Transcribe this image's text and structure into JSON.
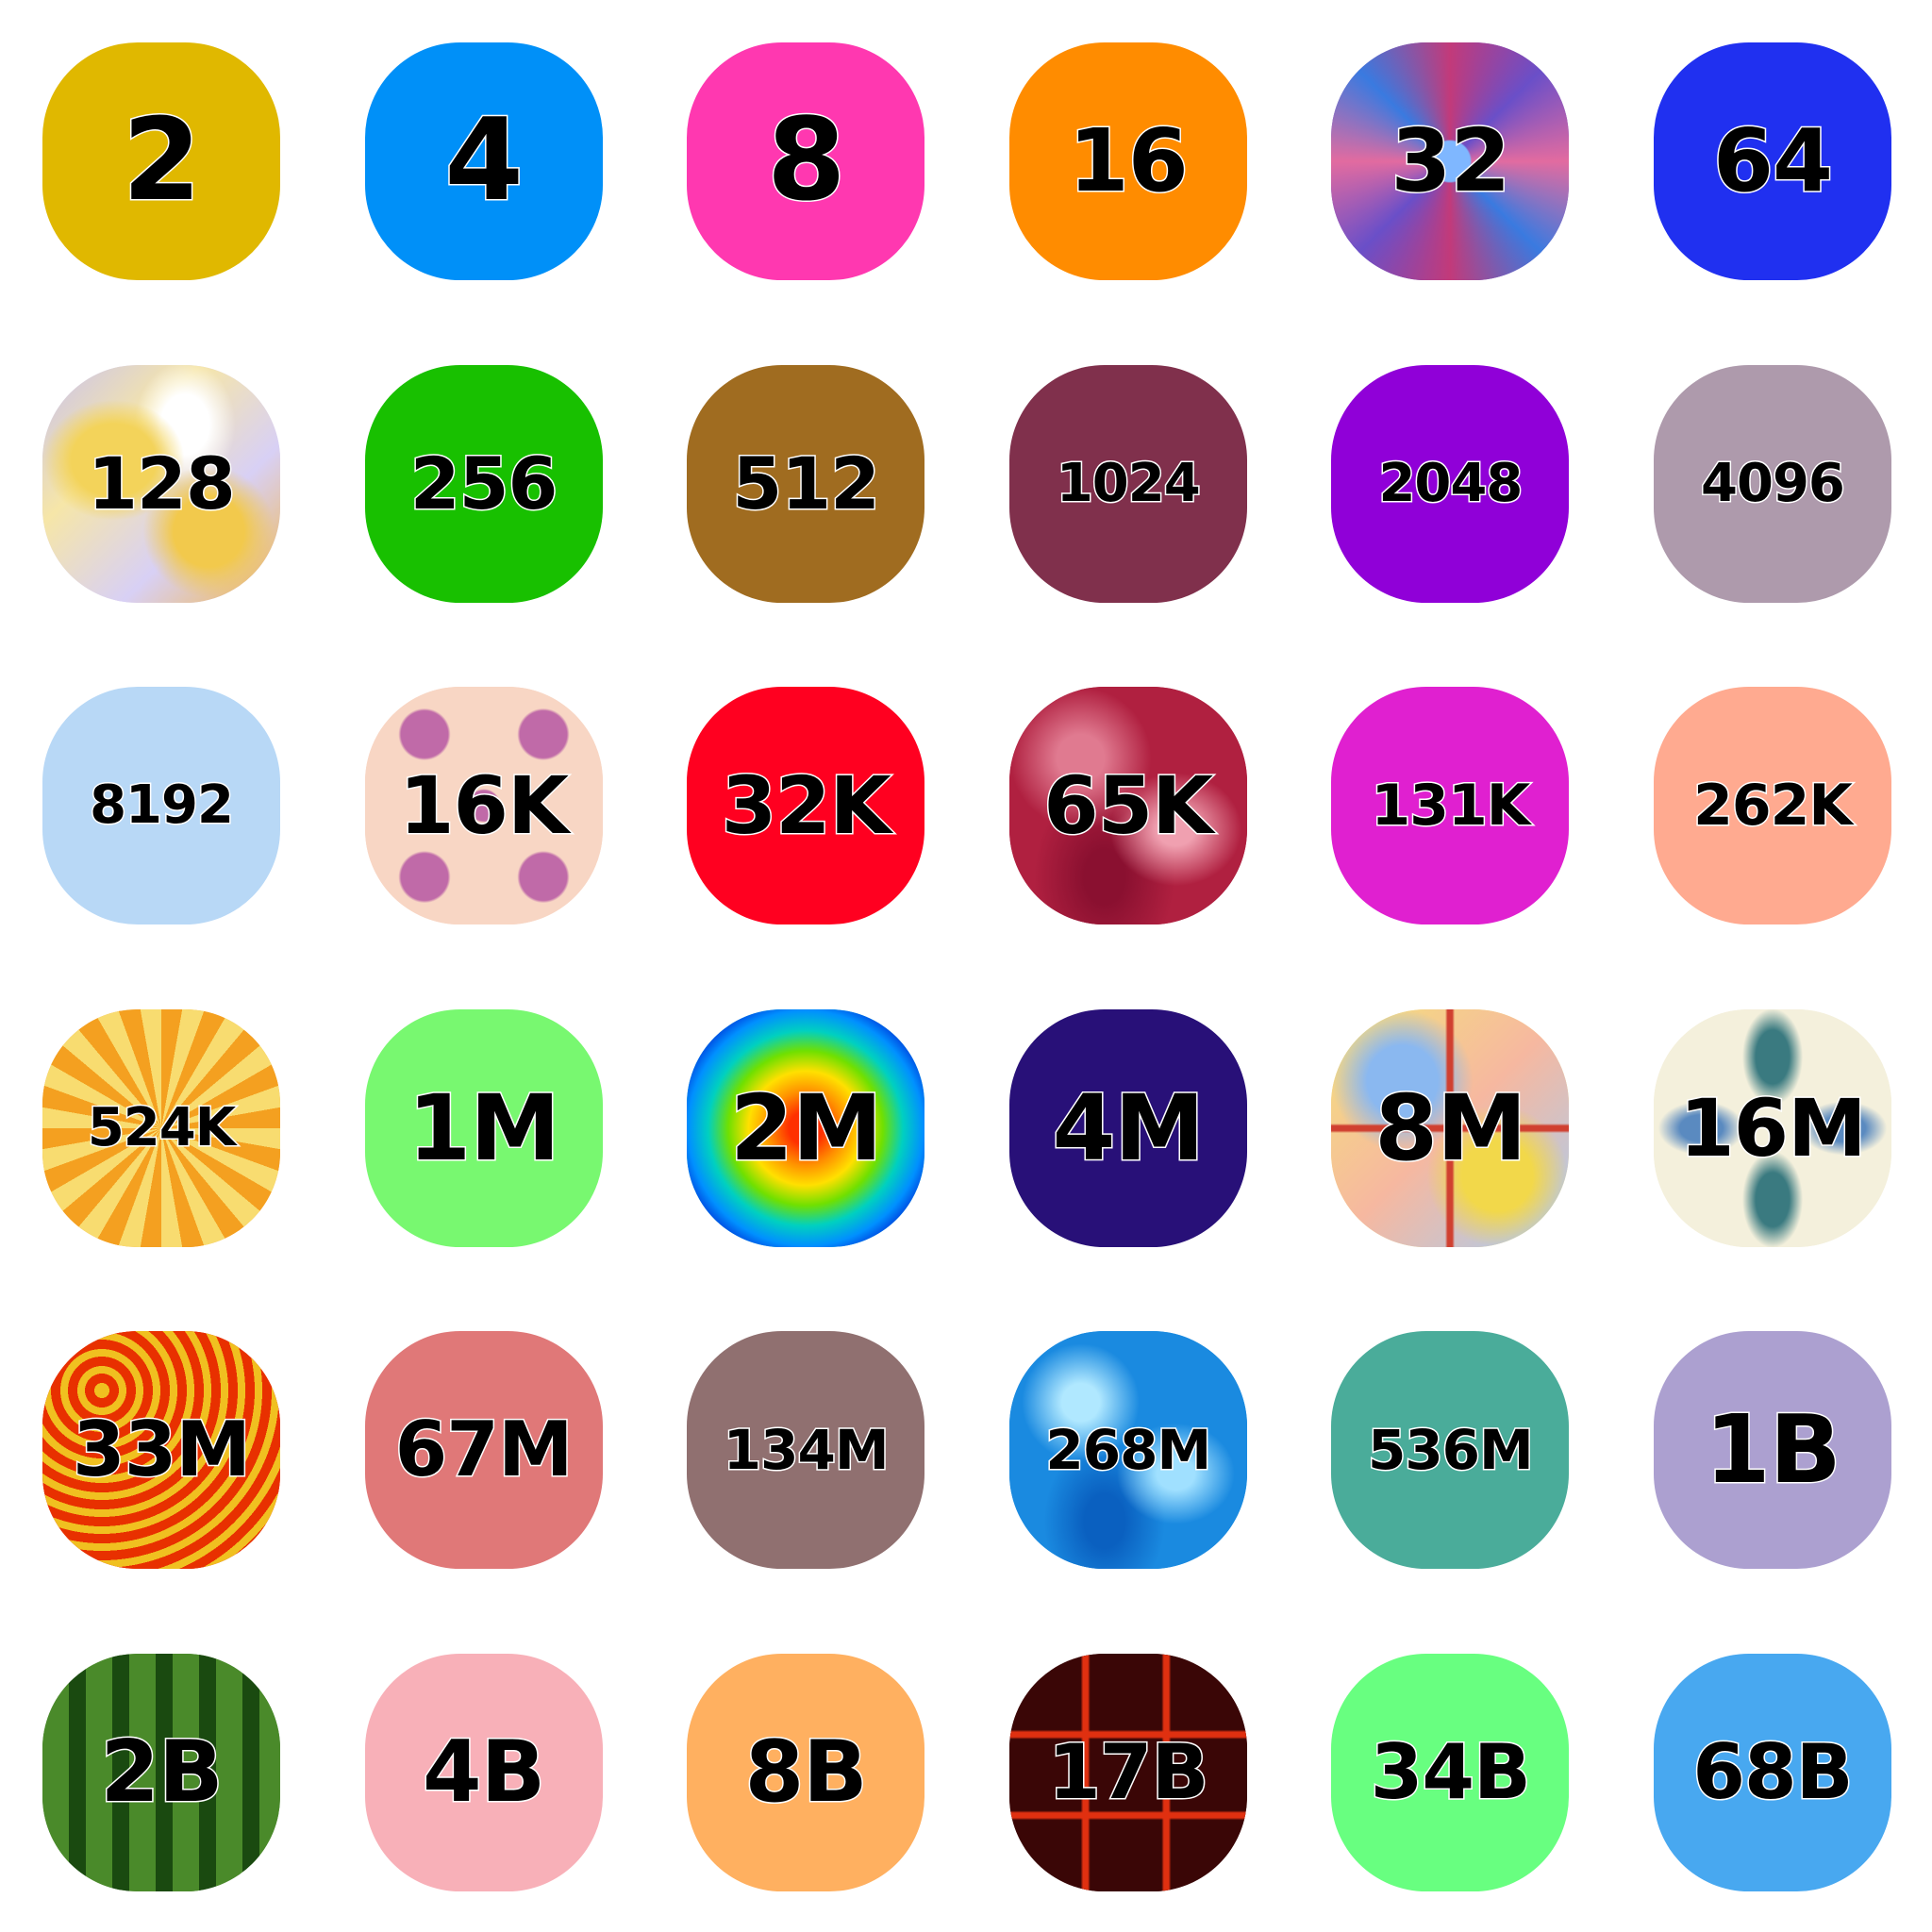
{
  "tiles": [
    {
      "label": "2",
      "color": "#e0b800",
      "pattern": null,
      "size": 120
    },
    {
      "label": "4",
      "color": "#0090f8",
      "pattern": null,
      "size": 120
    },
    {
      "label": "8",
      "color": "#ff38b0",
      "pattern": null,
      "size": 120
    },
    {
      "label": "16",
      "color": "#ff8c00",
      "pattern": null,
      "size": 92
    },
    {
      "label": "32",
      "color": "#6a4fc8",
      "pattern": "mandala",
      "size": 92
    },
    {
      "label": "64",
      "color": "#2030f0",
      "pattern": null,
      "size": 92
    },
    {
      "label": "128",
      "color": "#d8d0f5",
      "pattern": "marble",
      "size": 76
    },
    {
      "label": "256",
      "color": "#18c000",
      "pattern": null,
      "size": 76
    },
    {
      "label": "512",
      "color": "#a06c20",
      "pattern": null,
      "size": 76
    },
    {
      "label": "1024",
      "color": "#80304c",
      "pattern": null,
      "size": 56
    },
    {
      "label": "2048",
      "color": "#9000d8",
      "pattern": null,
      "size": 56
    },
    {
      "label": "4096",
      "color": "#ae9aac",
      "pattern": null,
      "size": 56
    },
    {
      "label": "8192",
      "color": "#b8d8f6",
      "pattern": null,
      "size": 56
    },
    {
      "label": "16K",
      "color": "#f8d6c4",
      "pattern": "flower",
      "size": 84
    },
    {
      "label": "32K",
      "color": "#ff0020",
      "pattern": null,
      "size": 84
    },
    {
      "label": "65K",
      "color": "#b02040",
      "pattern": "crimson",
      "size": 84
    },
    {
      "label": "131K",
      "color": "#e020d0",
      "pattern": null,
      "size": 60
    },
    {
      "label": "262K",
      "color": "#ffaa90",
      "pattern": null,
      "size": 60
    },
    {
      "label": "524K",
      "color": "#f4a020",
      "pattern": "sunburst",
      "size": 56
    },
    {
      "label": "1M",
      "color": "#78f870",
      "pattern": null,
      "size": 96
    },
    {
      "label": "2M",
      "color": "#00d0c0",
      "pattern": "rainbow",
      "size": 96
    },
    {
      "label": "4M",
      "color": "#281078",
      "pattern": null,
      "size": 96
    },
    {
      "label": "8M",
      "color": "#f4e27a",
      "pattern": "glass",
      "size": 96
    },
    {
      "label": "16M",
      "color": "#f4f0dc",
      "pattern": "leaves",
      "size": 84
    },
    {
      "label": "33M",
      "color": "#e83000",
      "pattern": "circles",
      "size": 80
    },
    {
      "label": "67M",
      "color": "#e07878",
      "pattern": null,
      "size": 80
    },
    {
      "label": "134M",
      "color": "#907070",
      "pattern": null,
      "size": 58
    },
    {
      "label": "268M",
      "color": "#1a8ae0",
      "pattern": "water",
      "size": 58
    },
    {
      "label": "536M",
      "color": "#4aac9a",
      "pattern": null,
      "size": 58
    },
    {
      "label": "1B",
      "color": "#aca0d0",
      "pattern": null,
      "size": 100
    },
    {
      "label": "2B",
      "color": "#3a7a20",
      "pattern": "melon",
      "size": 90
    },
    {
      "label": "4B",
      "color": "#f8b0b8",
      "pattern": null,
      "size": 90
    },
    {
      "label": "8B",
      "color": "#ffb060",
      "pattern": null,
      "size": 90
    },
    {
      "label": "17B",
      "color": "#3a0606",
      "pattern": "lava",
      "size": 80
    },
    {
      "label": "34B",
      "color": "#68ff80",
      "pattern": null,
      "size": 80
    },
    {
      "label": "68B",
      "color": "#48a8f0",
      "pattern": null,
      "size": 80
    }
  ]
}
